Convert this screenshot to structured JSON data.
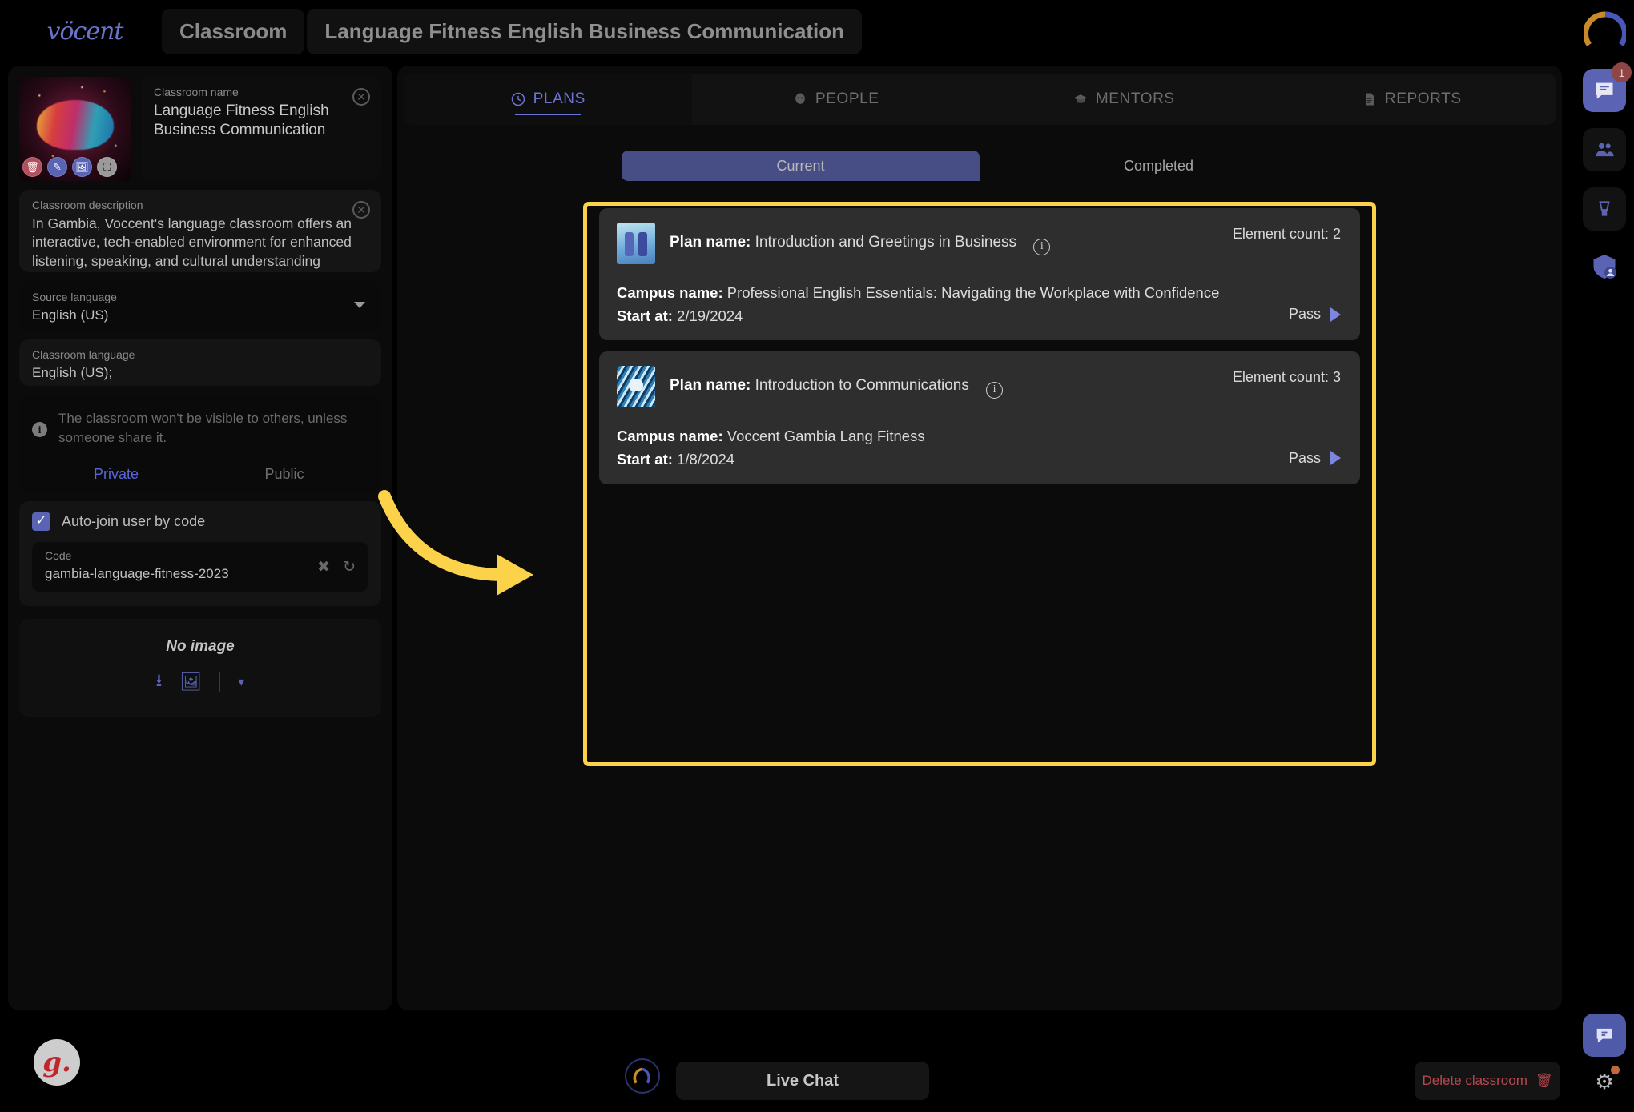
{
  "topbar": {
    "logo_text": "vöcent",
    "breadcrumb_section": "Classroom",
    "breadcrumb_title": "Language Fitness English Business Communication"
  },
  "left_panel": {
    "classroom_name_label": "Classroom name",
    "classroom_name_value": "Language Fitness English Business Communication",
    "classroom_description_label": "Classroom description",
    "classroom_description_value": "In Gambia, Voccent's language classroom offers an interactive, tech-enabled environment for enhanced listening, speaking, and cultural understanding through advanced speech recognition and emotional intelligence tools.",
    "source_language_label": "Source language",
    "source_language_value": "English (US)",
    "classroom_language_label": "Classroom language",
    "classroom_language_value": "English (US);",
    "privacy_note": "The classroom won't be visible to others, unless someone share it.",
    "privacy_private": "Private",
    "privacy_public": "Public",
    "privacy_selected": "Private",
    "autojoin_label": "Auto-join user by code",
    "autojoin_checked": true,
    "code_label": "Code",
    "code_value": "gambia-language-fitness-2023",
    "no_image_label": "No image",
    "thumb_actions": [
      "delete-icon",
      "edit-icon",
      "image-icon",
      "fullscreen-icon"
    ]
  },
  "main": {
    "tabs": [
      {
        "label": "PLANS",
        "icon": "clock-icon",
        "active": true
      },
      {
        "label": "PEOPLE",
        "icon": "person-icon",
        "active": false
      },
      {
        "label": "MENTORS",
        "icon": "graduation-cap-icon",
        "active": false
      },
      {
        "label": "REPORTS",
        "icon": "document-icon",
        "active": false
      }
    ],
    "segments": [
      {
        "label": "Current",
        "active": true
      },
      {
        "label": "Completed",
        "active": false
      }
    ],
    "labels": {
      "plan_name": "Plan name:",
      "campus_name": "Campus name:",
      "start_at": "Start at:",
      "element_count": "Element count:",
      "pass": "Pass"
    },
    "plans": [
      {
        "plan_name": "Introduction and Greetings in Business",
        "campus_name": "Professional English Essentials: Navigating the Workplace with Confidence",
        "start_at": "2/19/2024",
        "element_count": "2",
        "pass_label": "Pass"
      },
      {
        "plan_name": "Introduction to Communications",
        "campus_name": "Voccent Gambia Lang Fitness",
        "start_at": "1/8/2024",
        "element_count": "3",
        "pass_label": "Pass"
      }
    ]
  },
  "rail": {
    "message_badge": "1",
    "icons": [
      "chat-icon",
      "people-icon",
      "blender-icon",
      "shield-user-icon"
    ]
  },
  "bottom": {
    "avatar_letter": "g.",
    "live_chat_label": "Live Chat",
    "delete_label": "Delete classroom"
  },
  "colors": {
    "accent": "#5b63b5",
    "highlight": "#fbd24a",
    "danger": "#b8484f",
    "segment_active": "#474e86"
  }
}
